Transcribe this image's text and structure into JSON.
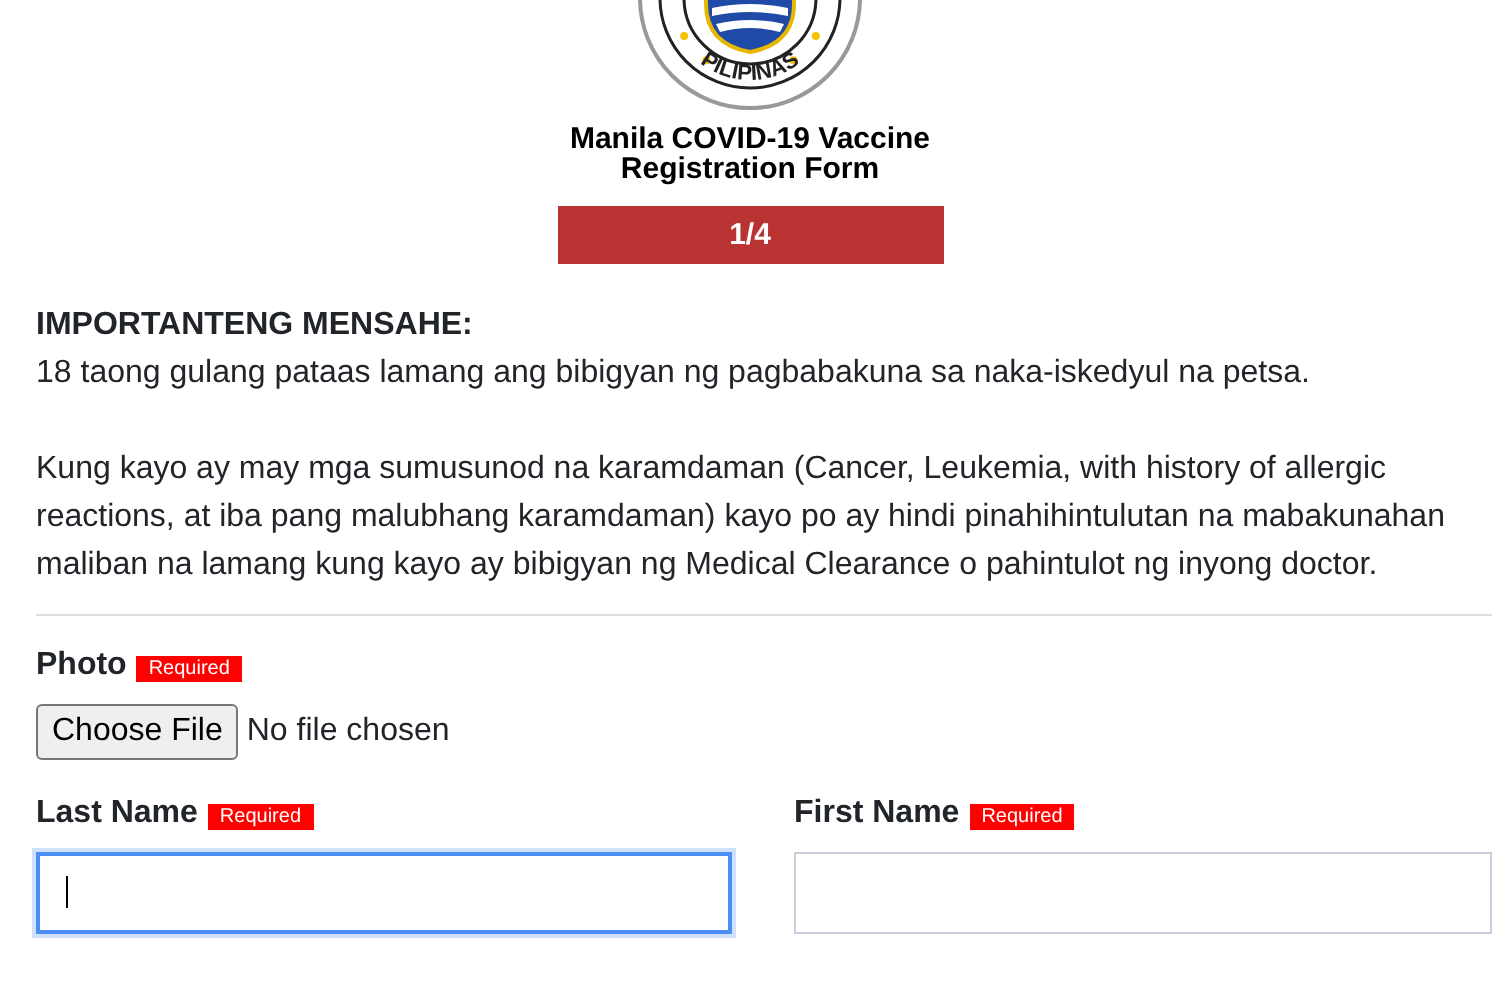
{
  "header": {
    "seal_text": "PILIPINAS",
    "title_lines": [
      "Manila COVID-19 Vaccine",
      "Registration Form"
    ],
    "step": "1/4"
  },
  "notice": {
    "heading": "IMPORTANTENG MENSAHE:",
    "paragraphs": [
      "18 taong gulang pataas lamang ang bibigyan ng pagbabakuna sa naka-iskedyul na petsa.",
      "Kung kayo ay may mga sumusunod na karamdaman (Cancer, Leukemia, with history of allergic reactions, at iba pang malubhang karamdaman) kayo po ay hindi pinahihintulutan na mabakunahan maliban na lamang kung kayo ay bibigyan ng Medical Clearance o pahintulot ng inyong doctor."
    ]
  },
  "photo": {
    "label": "Photo",
    "badge": "Required",
    "button": "Choose File",
    "status": "No file chosen"
  },
  "fields": [
    {
      "label": "Last Name",
      "badge": "Required",
      "focused": true
    },
    {
      "label": "First Name",
      "badge": "Required",
      "focused": false
    }
  ]
}
